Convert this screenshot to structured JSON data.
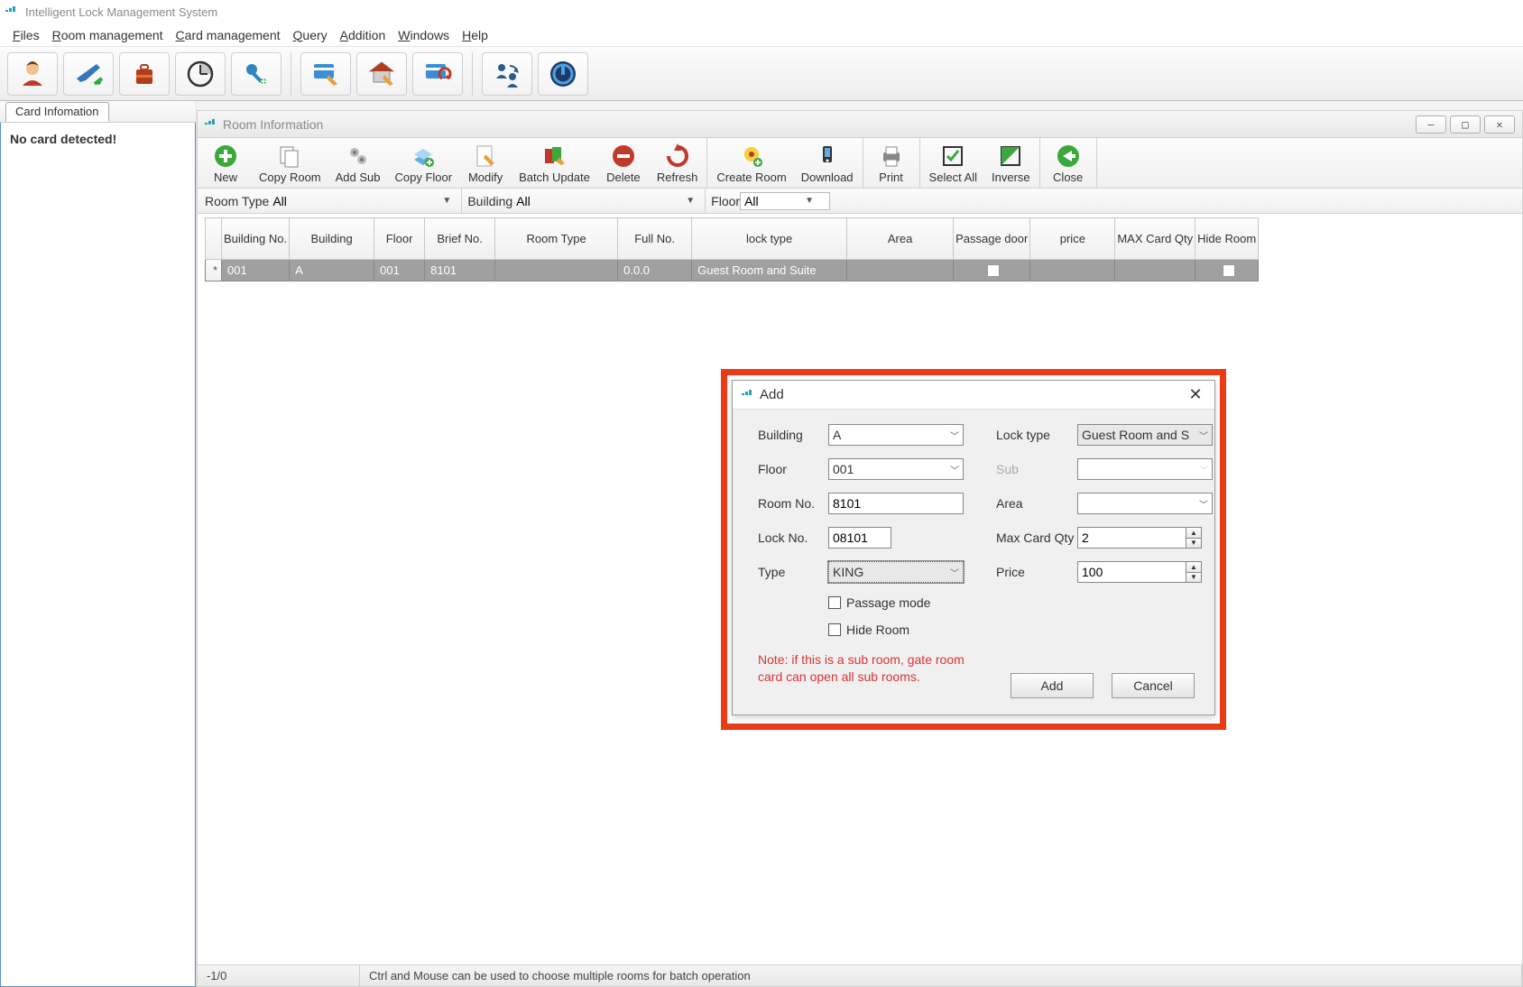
{
  "app": {
    "title": "Intelligent Lock Management System"
  },
  "menu": {
    "files": "Files",
    "room": "Room management",
    "card": "Card management",
    "query": "Query",
    "addition": "Addition",
    "windows": "Windows",
    "help": "Help"
  },
  "left_panel": {
    "tab": "Card Infomation",
    "message": "No card detected!"
  },
  "child_window": {
    "title": "Room Information",
    "toolbar": {
      "new": "New",
      "copy_room": "Copy Room",
      "add_sub": "Add Sub",
      "copy_floor": "Copy Floor",
      "modify": "Modify",
      "batch_update": "Batch Update",
      "delete": "Delete",
      "refresh": "Refresh",
      "create_room": "Create Room",
      "download": "Download",
      "print": "Print",
      "select_all": "Select All",
      "inverse": "Inverse",
      "close": "Close"
    },
    "filter": {
      "room_type_label": "Room Type",
      "room_type_value": "All",
      "building_label": "Building",
      "building_value": "All",
      "floor_label": "Floor",
      "floor_value": "All"
    },
    "columns": {
      "building_no": "Building No.",
      "building": "Building",
      "floor": "Floor",
      "brief_no": "Brief No.",
      "room_type": "Room Type",
      "full_no": "Full No.",
      "lock_type": "lock type",
      "area": "Area",
      "passage_door": "Passage door",
      "price": "price",
      "max_card_qty": "MAX Card Qty",
      "hide_room": "Hide Room"
    },
    "rows": [
      {
        "building_no": "001",
        "building": "A",
        "floor": "001",
        "brief_no": "8101",
        "room_type": "",
        "full_no": "0.0.0",
        "lock_type": "Guest Room and Suite",
        "area": "",
        "passage_door": false,
        "price": "",
        "max_card_qty": "",
        "hide_room": false
      }
    ],
    "status": {
      "counter": "-1/0",
      "hint": "Ctrl and Mouse can be used to choose multiple rooms for batch operation"
    }
  },
  "add_dialog": {
    "title": "Add",
    "labels": {
      "building": "Building",
      "floor": "Floor",
      "room_no": "Room No.",
      "lock_no": "Lock No.",
      "type": "Type",
      "lock_type": "Lock type",
      "sub": "Sub",
      "area": "Area",
      "max_card_qty": "Max Card Qty",
      "price": "Price",
      "passage_mode": "Passage mode",
      "hide_room": "Hide Room"
    },
    "values": {
      "building": "A",
      "floor": "001",
      "room_no": "8101",
      "lock_no": "08101",
      "type": "KING",
      "lock_type": "Guest Room and S",
      "sub": "",
      "area": "",
      "max_card_qty": "2",
      "price": "100",
      "passage_mode": false,
      "hide_room": false
    },
    "note": "Note: if this is a sub room, gate room card can open all sub rooms.",
    "buttons": {
      "add": "Add",
      "cancel": "Cancel"
    }
  }
}
